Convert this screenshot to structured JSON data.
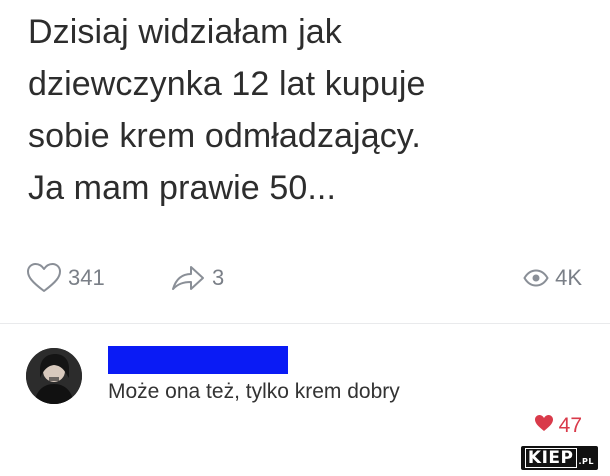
{
  "post": {
    "lines": [
      "Dzisiaj widziałam jak",
      "dziewczynka 12 lat kupuje",
      "sobie krem odmładzający.",
      "Ja mam prawie 50..."
    ]
  },
  "actions": {
    "likes_count": "341",
    "shares_count": "3",
    "views_count": "4K",
    "icons": {
      "like": "heart-outline-icon",
      "share": "share-arrow-icon",
      "views": "eye-icon"
    }
  },
  "comment": {
    "text": "Może ona też, tylko krem dobry",
    "likes_count": "47",
    "author_redacted_color": "#0a1bf5",
    "like_color": "#d93a4a"
  },
  "watermark": {
    "text": "KIEP",
    "tld": ".PL"
  }
}
